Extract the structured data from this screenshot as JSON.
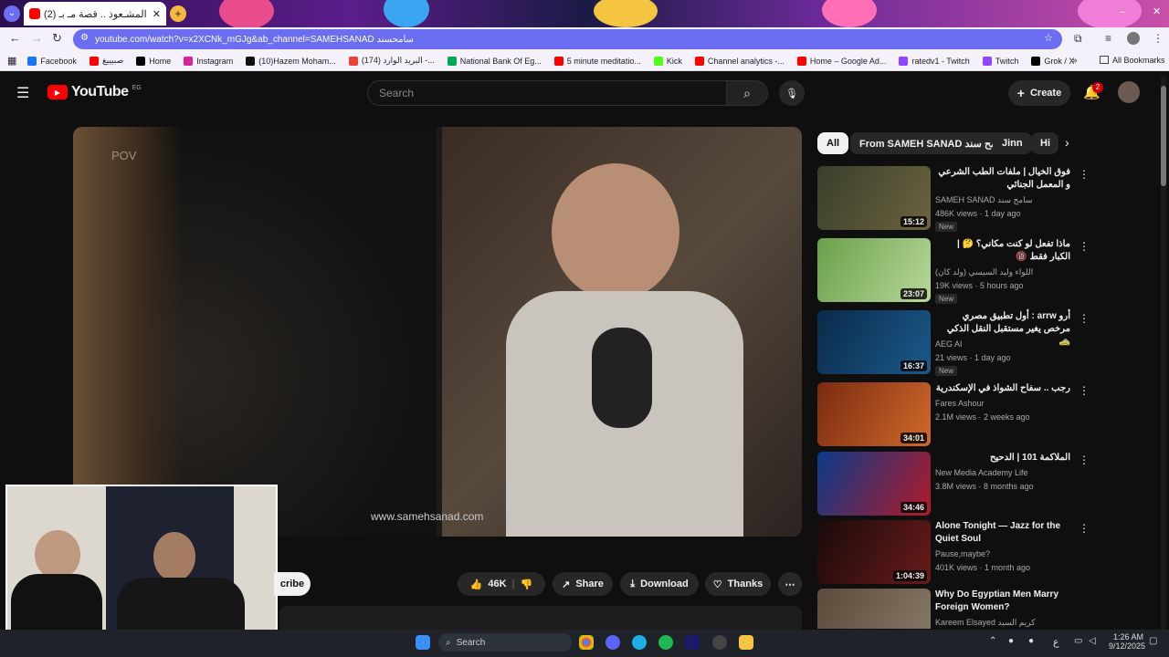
{
  "browser": {
    "tab_title": "(2) المشـعوذ .. قصة مـ بـ",
    "url": "youtube.com/watch?v=x2XCNk_mGJg&ab_channel=SAMEHSANAD سامحسند",
    "bookmarks": [
      "Facebook",
      "صبيييغ",
      "Home",
      "Instagram",
      "(10)Hazem Moham...",
      "(174) البريد الوارد -...",
      "National Bank Of Eg...",
      "5 minute meditatio...",
      "Kick",
      "Channel analytics -...",
      "Home – Google Ad...",
      "ratedv1 - Twitch",
      "Twitch",
      "Grok / X"
    ],
    "all_bookmarks": "All Bookmarks"
  },
  "youtube": {
    "logo": "YouTube",
    "country": "EG",
    "search_placeholder": "Search",
    "create_label": "Create",
    "notif_count": "2"
  },
  "video": {
    "overlay_pov": "POV",
    "watermark": "www.samehsanad.com",
    "subscribe_label": "cribe",
    "likes": "46K",
    "share": "Share",
    "download": "Download",
    "thanks": "Thanks"
  },
  "chips": [
    "All",
    "From SAMEH SANAD سامح سند",
    "Jinn",
    "Hi"
  ],
  "recommendations": [
    {
      "title": "فوق الخيال | ملفات الطب الشرعي و المعمل الجنائي",
      "channel": "SAMEH SANAD سامح سند",
      "meta": "486K views · 1 day ago",
      "badge": "New",
      "duration": "15:12"
    },
    {
      "title": "ماذا تفعل لو كنت مكاني؟ 🤔 | الكبار فقط 🔞",
      "channel": "اللواء وليد السيسي (ولد كان)",
      "meta": "19K views · 5 hours ago",
      "badge": "New",
      "duration": "23:07"
    },
    {
      "title": "أرو arrw : أول تطبيق مصري مرخص يغير مستقبل النقل الذكي 🚕",
      "channel": "AEG AI",
      "meta": "21 views · 1 day ago",
      "badge": "New",
      "duration": "16:37"
    },
    {
      "title": "رجب .. سفاح الشواذ في الإسكندرية",
      "channel": "Fares Ashour",
      "meta": "2.1M views · 2 weeks ago",
      "badge": "",
      "duration": "34:01"
    },
    {
      "title": "الملاكمة 101 | الدحيح",
      "channel": "New Media Academy Life",
      "meta": "3.8M views · 8 months ago",
      "badge": "",
      "duration": "34:46"
    },
    {
      "title": "Alone Tonight — Jazz for the Quiet Soul",
      "channel": "Pause,maybe?",
      "meta": "401K views · 1 month ago",
      "badge": "",
      "duration": "1:04:39"
    },
    {
      "title": "Why Do Egyptian Men Marry Foreign Women?",
      "channel": "Kareem Elsayed كريم السيد",
      "meta": "",
      "badge": "",
      "duration": ""
    }
  ],
  "taskbar": {
    "search": "Search",
    "time": "1:26 AM",
    "date": "9/12/2025",
    "lang": "ع"
  }
}
